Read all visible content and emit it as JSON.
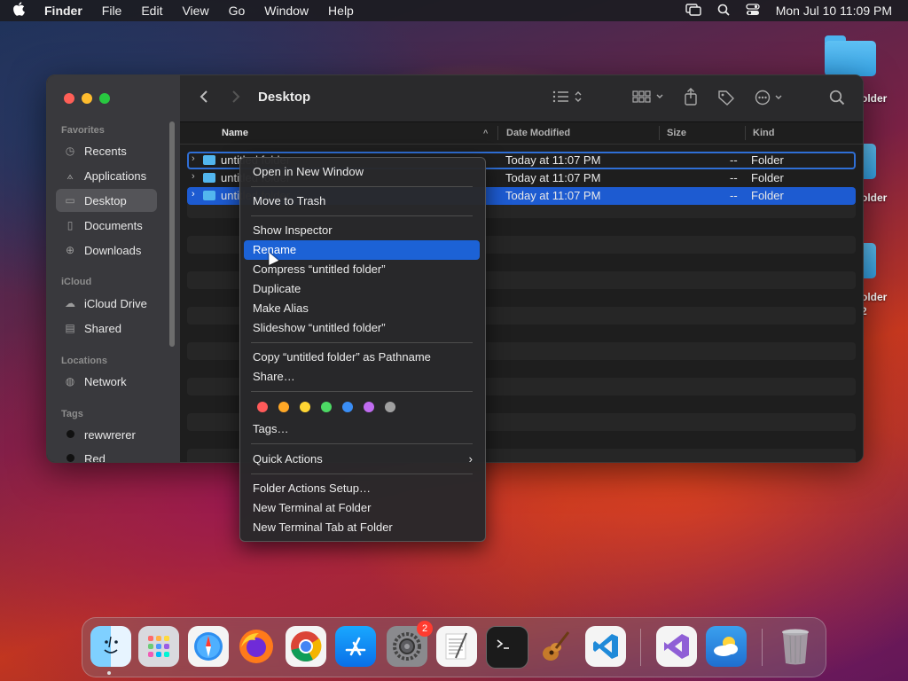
{
  "menubar": {
    "apple_icon": "apple-logo-icon",
    "app_name": "Finder",
    "items": [
      "File",
      "Edit",
      "View",
      "Go",
      "Window",
      "Help"
    ],
    "clock": "Mon Jul 10  11:09 PM"
  },
  "desktop": {
    "labels": [
      "older",
      "older",
      "older",
      "2"
    ]
  },
  "sidebar": {
    "favorites_header": "Favorites",
    "favorites": [
      {
        "label": "Recents",
        "icon": "clock-icon"
      },
      {
        "label": "Applications",
        "icon": "applications-icon"
      },
      {
        "label": "Desktop",
        "icon": "desktop-icon"
      },
      {
        "label": "Documents",
        "icon": "document-icon"
      },
      {
        "label": "Downloads",
        "icon": "download-icon"
      }
    ],
    "icloud_header": "iCloud",
    "icloud": [
      {
        "label": "iCloud Drive",
        "icon": "cloud-icon"
      },
      {
        "label": "Shared",
        "icon": "shared-folder-icon"
      }
    ],
    "locations_header": "Locations",
    "locations": [
      {
        "label": "Network",
        "icon": "globe-icon"
      }
    ],
    "tags_header": "Tags",
    "tags": [
      {
        "label": "rewwrerer",
        "color": "#111111"
      },
      {
        "label": "Red",
        "color": "#ff4b4b"
      }
    ]
  },
  "toolbar": {
    "title": "Desktop"
  },
  "columns": {
    "name": "Name",
    "date": "Date Modified",
    "size": "Size",
    "kind": "Kind"
  },
  "rows": [
    {
      "name": "untitled folder",
      "date": "Today at 11:07 PM",
      "size": "--",
      "kind": "Folder"
    },
    {
      "name": "untitled folder",
      "date": "Today at 11:07 PM",
      "size": "--",
      "kind": "Folder"
    },
    {
      "name": "untitled folder",
      "date": "Today at 11:07 PM",
      "size": "--",
      "kind": "Folder"
    }
  ],
  "context_menu": {
    "open_new_window": "Open in New Window",
    "move_to_trash": "Move to Trash",
    "show_inspector": "Show Inspector",
    "rename": "Rename",
    "compress": "Compress “untitled folder”",
    "duplicate": "Duplicate",
    "make_alias": "Make Alias",
    "slideshow": "Slideshow “untitled folder”",
    "copy_pathname": "Copy “untitled folder” as Pathname",
    "share": "Share…",
    "tag_colors": [
      "#ff5a5a",
      "#ffa726",
      "#ffd633",
      "#4cd964",
      "#3a8ef6",
      "#c06cf0",
      "#a0a0a0"
    ],
    "tags": "Tags…",
    "quick_actions": "Quick Actions",
    "folder_actions_setup": "Folder Actions Setup…",
    "new_terminal": "New Terminal at Folder",
    "new_terminal_tab": "New Terminal Tab at Folder"
  },
  "dock": {
    "apps": [
      {
        "name": "Finder",
        "icon": "finder-icon"
      },
      {
        "name": "Launchpad",
        "icon": "launchpad-icon"
      },
      {
        "name": "Safari",
        "icon": "safari-icon"
      },
      {
        "name": "Firefox",
        "icon": "firefox-icon"
      },
      {
        "name": "Chrome",
        "icon": "chrome-icon"
      },
      {
        "name": "App Store",
        "icon": "app-store-icon"
      },
      {
        "name": "System Settings",
        "icon": "settings-gear-icon",
        "badge": "2"
      },
      {
        "name": "TextEdit",
        "icon": "textedit-icon"
      },
      {
        "name": "Terminal",
        "icon": "terminal-icon"
      },
      {
        "name": "Instruments",
        "icon": "guitar-icon"
      },
      {
        "name": "Visual Studio Code",
        "icon": "vscode-icon"
      },
      {
        "name": "Visual Studio",
        "icon": "visual-studio-icon"
      },
      {
        "name": "Weather",
        "icon": "weather-icon"
      },
      {
        "name": "Trash",
        "icon": "trash-icon"
      }
    ]
  }
}
